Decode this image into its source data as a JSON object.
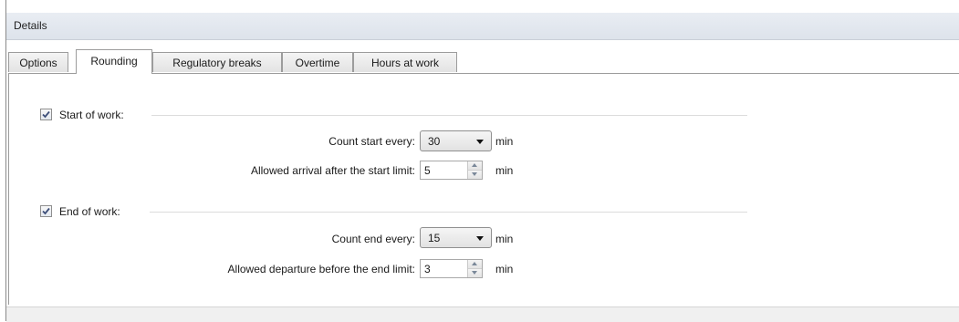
{
  "header": {
    "title": "Details"
  },
  "tabs": [
    {
      "label": "Options"
    },
    {
      "label": "Rounding",
      "active": true
    },
    {
      "label": "Regulatory breaks"
    },
    {
      "label": "Overtime"
    },
    {
      "label": "Hours at work"
    }
  ],
  "start_of_work": {
    "label": "Start of work:",
    "checked": true,
    "count_label": "Count start every:",
    "count_value": "30",
    "count_unit": "min",
    "allowed_label": "Allowed arrival after the start limit:",
    "allowed_value": "5",
    "allowed_unit": "min"
  },
  "end_of_work": {
    "label": "End of work:",
    "checked": true,
    "count_label": "Count end every:",
    "count_value": "15",
    "count_unit": "min",
    "allowed_label": "Allowed departure before the end limit:",
    "allowed_value": "3",
    "allowed_unit": "min"
  },
  "icons": {
    "checkmark": "checkmark-icon",
    "dropdown": "chevron-down-icon",
    "spin_up": "spin-up-icon",
    "spin_down": "spin-down-icon"
  },
  "colors": {
    "header_bg": "#e3e8ef",
    "check_color": "#3d4f7a",
    "border": "#9c9c9c"
  }
}
